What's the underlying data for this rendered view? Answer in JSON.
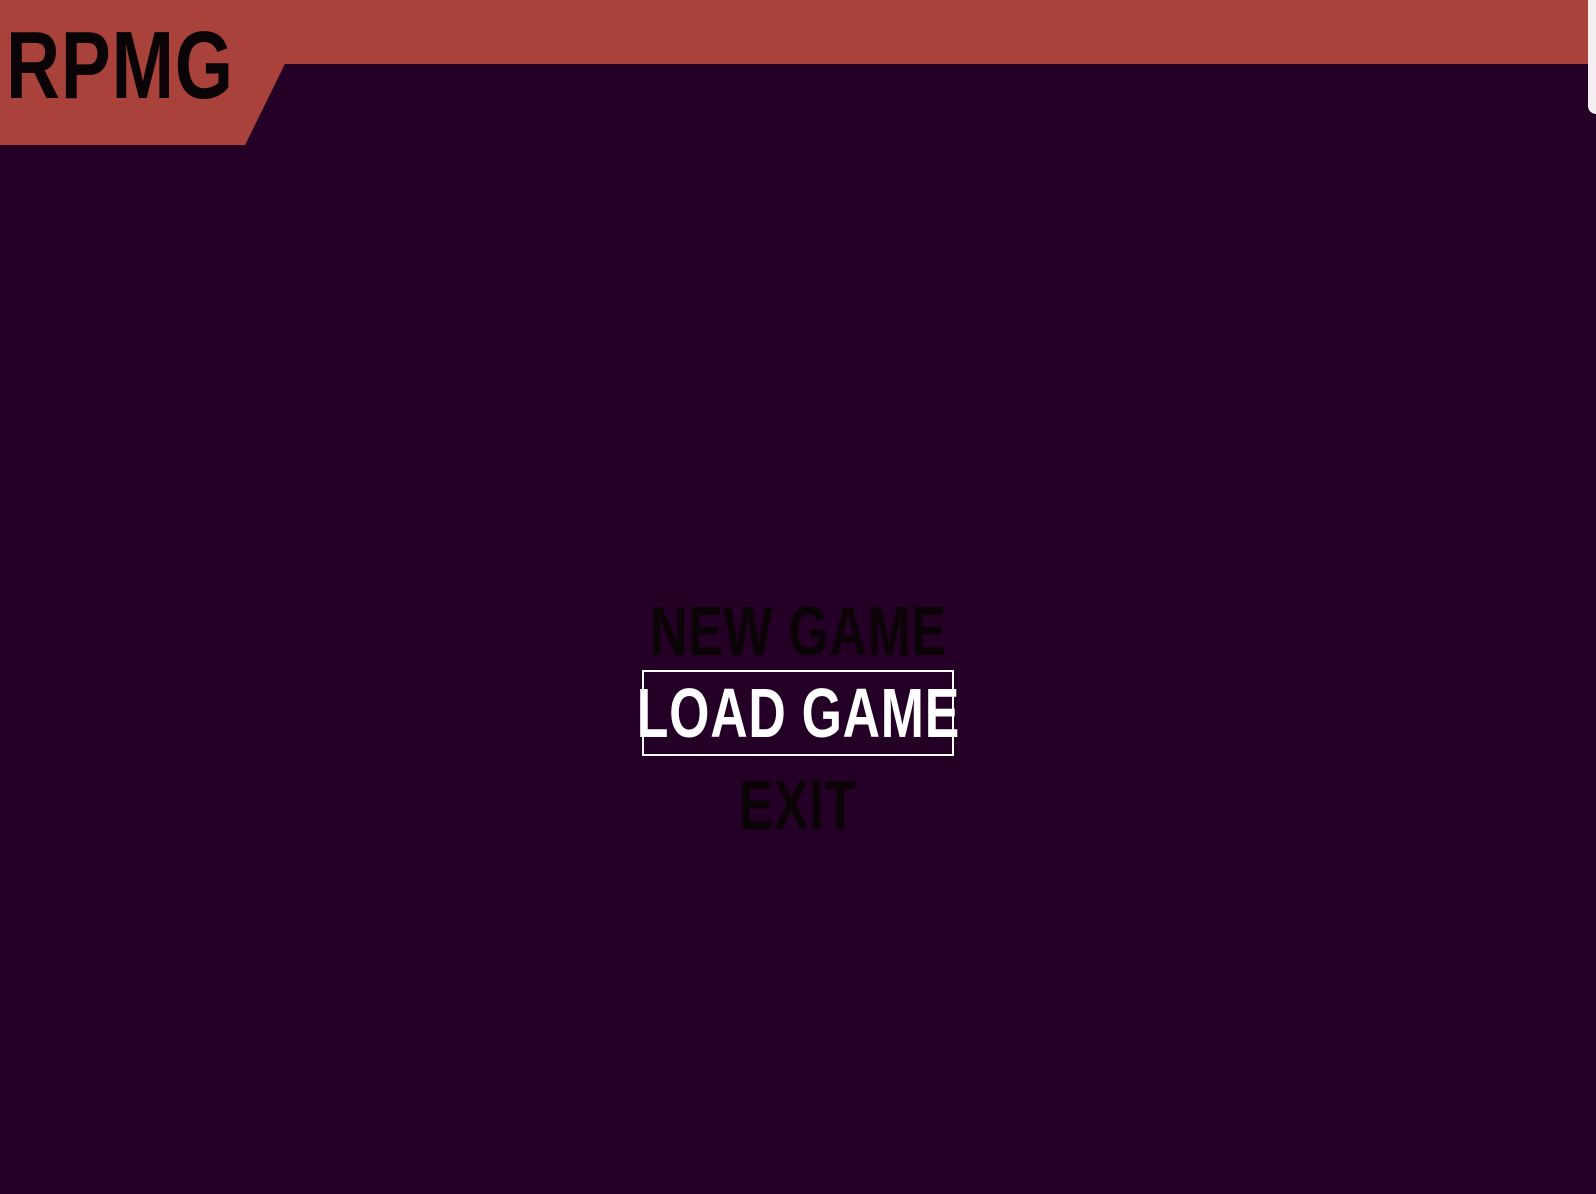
{
  "game": {
    "logo": "RPMG"
  },
  "menu": {
    "items": [
      {
        "label": "NEW GAME",
        "selected": false
      },
      {
        "label": "LOAD GAME",
        "selected": true
      },
      {
        "label": "EXIT",
        "selected": false
      }
    ]
  },
  "colors": {
    "background": "#240026",
    "accent": "#a8423a",
    "text_dim": "#0a0406",
    "text_selected": "#ffffff"
  }
}
